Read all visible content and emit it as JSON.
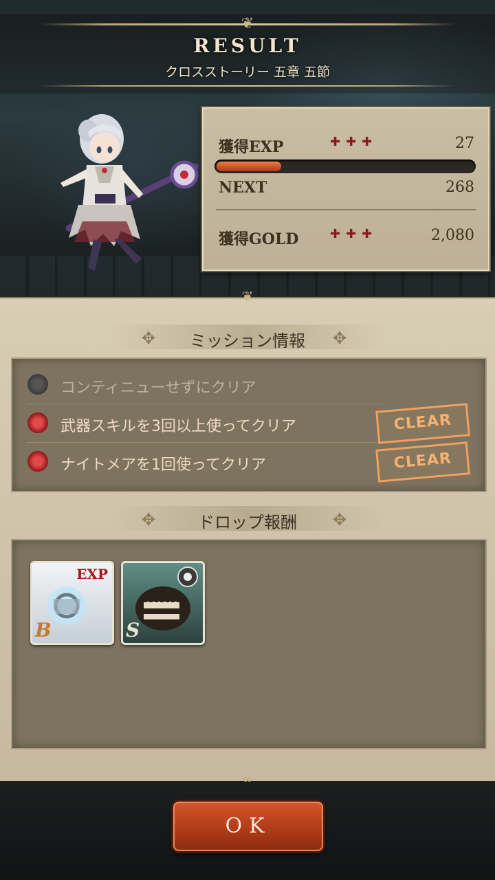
{
  "header": {
    "title": "RESULT",
    "stage": "クロスストーリー 五章 五節"
  },
  "stats": {
    "exp_label": "獲得EXP",
    "exp_value": "27",
    "exp_progress": 0.25,
    "next_label": "NEXT",
    "next_value": "268",
    "gold_label": "獲得GOLD",
    "gold_value": "2,080",
    "crosses": "✚✚✚"
  },
  "missions": {
    "title": "ミッション情報",
    "items": [
      {
        "text": "コンティニューせずにクリア",
        "cleared": false
      },
      {
        "text": "武器スキルを3回以上使ってクリア",
        "cleared": true,
        "stamp": "CLEAR"
      },
      {
        "text": "ナイトメアを1回使ってクリア",
        "cleared": true,
        "stamp": "CLEAR"
      }
    ]
  },
  "drops": {
    "title": "ドロップ報酬",
    "items": [
      {
        "rank": "B",
        "badge": "EXP",
        "icon": "exp-weapon-icon"
      },
      {
        "rank": "S",
        "badge": "",
        "icon": "nightmare-icon"
      }
    ]
  },
  "footer": {
    "ok_label": "OK"
  },
  "colors": {
    "accent": "#b8441e",
    "clear": "#f0a060",
    "parchment": "#d3c7ae"
  }
}
